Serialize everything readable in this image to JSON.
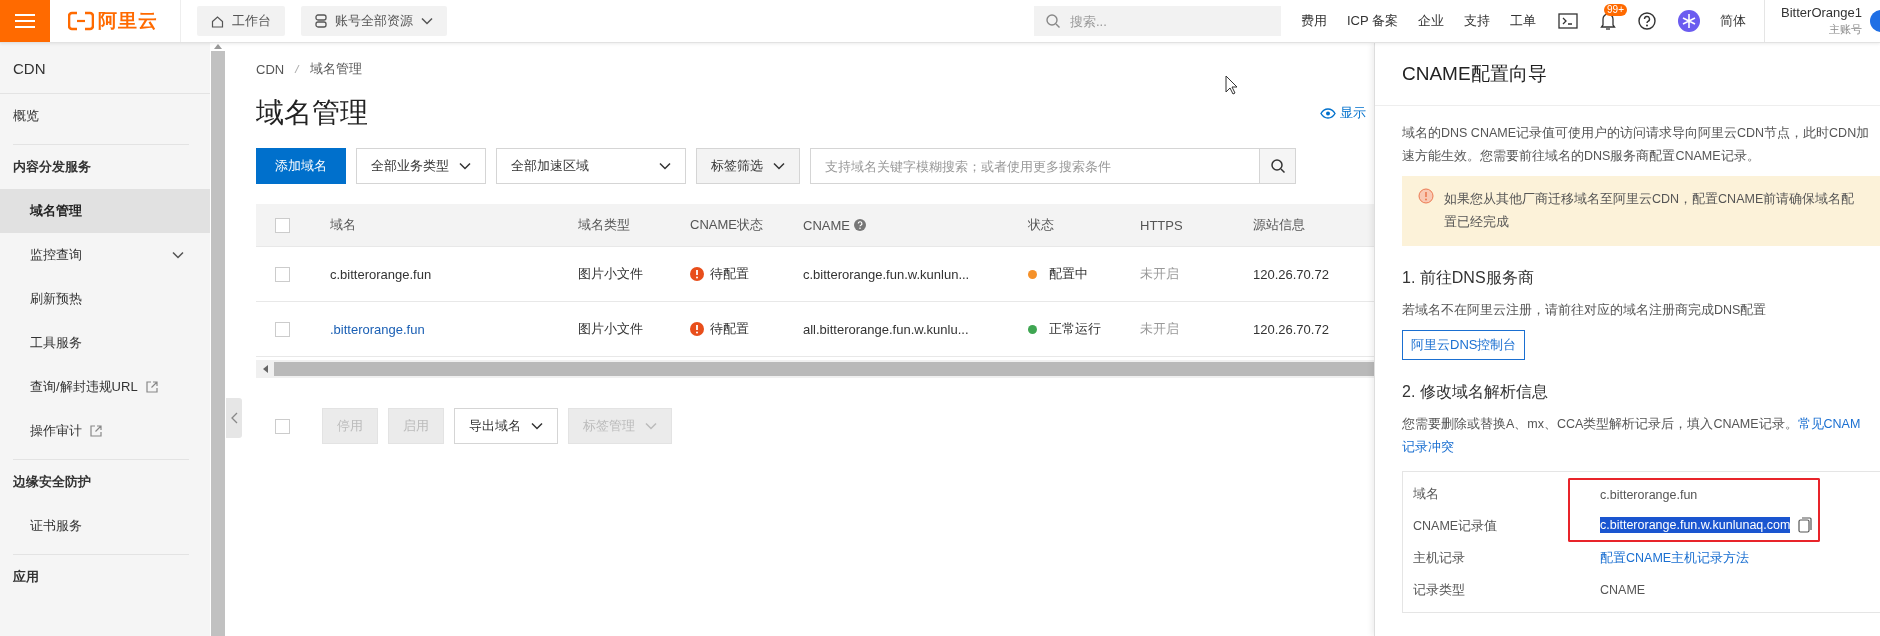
{
  "topbar": {
    "logo": "阿里云",
    "workbench": "工作台",
    "resources": "账号全部资源",
    "search": {
      "placeholder": "搜索..."
    },
    "links": [
      "费用",
      "ICP 备案",
      "企业",
      "支持",
      "工单"
    ],
    "notification_badge": "99+",
    "language": "简体",
    "account": {
      "name": "BitterOrange1",
      "role": "主账号"
    }
  },
  "sidebar": {
    "title": "CDN",
    "sections": [
      {
        "items": [
          {
            "label": "概览",
            "selected": false,
            "expandable": false,
            "external": false
          }
        ]
      },
      {
        "heading": "内容分发服务",
        "items": [
          {
            "label": "域名管理",
            "selected": true,
            "expandable": false,
            "external": false
          },
          {
            "label": "监控查询",
            "selected": false,
            "expandable": true,
            "external": false
          },
          {
            "label": "刷新预热",
            "selected": false,
            "expandable": false,
            "external": false
          },
          {
            "label": "工具服务",
            "selected": false,
            "expandable": false,
            "external": false
          },
          {
            "label": "查询/解封违规URL",
            "selected": false,
            "expandable": false,
            "external": true
          },
          {
            "label": "操作审计",
            "selected": false,
            "expandable": false,
            "external": true
          }
        ]
      },
      {
        "heading": "边缘安全防护",
        "items": [
          {
            "label": "证书服务",
            "selected": false,
            "expandable": false,
            "external": false
          }
        ]
      },
      {
        "heading": "应用"
      }
    ]
  },
  "breadcrumb": [
    "CDN",
    "域名管理"
  ],
  "page_title": "域名管理",
  "show_new": "显示",
  "toolbar": {
    "add_button": "添加域名",
    "filters": [
      "全部业务类型",
      "全部加速区域",
      "标签筛选"
    ],
    "search": {
      "placeholder": "支持域名关键字模糊搜索；或者使用更多搜索条件"
    }
  },
  "table": {
    "select_all": false,
    "columns": [
      "域名",
      "域名类型",
      "CNAME状态",
      "CNAME",
      "状态",
      "HTTPS",
      "源站信息"
    ],
    "rows": [
      {
        "checked": false,
        "domain": "c.bitterorange.fun",
        "link": false,
        "type": "图片小文件",
        "cname_status": "待配置",
        "cname": "c.bitterorange.fun.w.kunlun...",
        "status": "配置中",
        "color": "#f5912a",
        "https": "未开启",
        "origin": "120.26.70.72"
      },
      {
        "checked": false,
        "domain": ".bitterorange.fun",
        "link": true,
        "type": "图片小文件",
        "cname_status": "待配置",
        "cname": "all.bitterorange.fun.w.kunlu...",
        "status": "正常运行",
        "color": "#3fa652",
        "https": "未开启",
        "origin": "120.26.70.72"
      }
    ]
  },
  "bulk": {
    "select_all": false,
    "actions": [
      {
        "label": "停用",
        "disabled": true,
        "dropdown": false
      },
      {
        "label": "启用",
        "disabled": true,
        "dropdown": false
      },
      {
        "label": "导出域名",
        "disabled": false,
        "dropdown": true
      },
      {
        "label": "标签管理",
        "disabled": true,
        "dropdown": true
      }
    ]
  },
  "drawer": {
    "title": "CNAME配置向导",
    "intro_lines": [
      "域名的DNS CNAME记录值可使用户的访问请求导向阿里云CDN节点，此时CDN加",
      "速方能生效。您需要前往域名的DNS服务商配置CNAME记录。"
    ],
    "notice": "如果您从其他厂商迁移域名至阿里云CDN，配置CNAME前请确保域名配置已经完成",
    "step1": {
      "title": "1. 前往DNS服务商",
      "text": "若域名不在阿里云注册，请前往对应的域名注册商完成DNS配置",
      "button": "阿里云DNS控制台"
    },
    "step2": {
      "title": "2. 修改域名解析信息",
      "text": "您需要删除或替换A、mx、CCA类型解析记录后，填入CNAME记录。",
      "link": "常见CNAM",
      "link_cont": "记录冲突"
    },
    "records": [
      {
        "label": "域名",
        "value": "c.bitterorange.fun",
        "kind": "text",
        "highlighted": true
      },
      {
        "label": "CNAME记录值",
        "value": "c.bitterorange.fun.w.kunlunaq.com",
        "kind": "copy",
        "highlighted": true
      },
      {
        "label": "主机记录",
        "value": "配置CNAME主机记录方法",
        "kind": "link",
        "highlighted": false
      },
      {
        "label": "记录类型",
        "value": "CNAME",
        "kind": "text",
        "highlighted": false
      }
    ]
  }
}
